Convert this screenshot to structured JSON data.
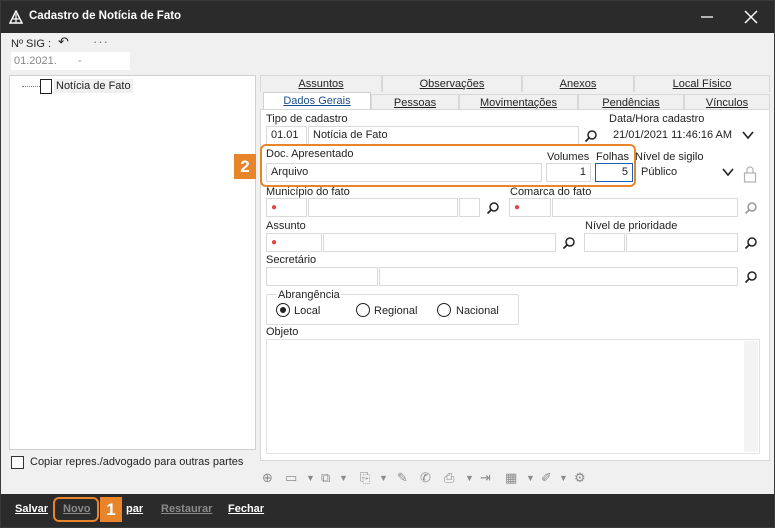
{
  "window": {
    "title": "Cadastro de Notícia de Fato"
  },
  "header": {
    "sig_label": "Nº SIG :",
    "sig_value_a": "01.2021.",
    "sig_value_b": "-"
  },
  "tree": {
    "root_label": "Notícia de Fato"
  },
  "options": {
    "copy_label": "Copiar repres./advogado para outras partes"
  },
  "tabs_top": [
    "Assuntos",
    "Observações",
    "Anexos",
    "Local Físico"
  ],
  "tabs_bottom": [
    "Dados Gerais",
    "Pessoas",
    "Movimentações",
    "Pendências",
    "Vínculos"
  ],
  "form": {
    "tipo_label": "Tipo de cadastro",
    "tipo_code": "01.01",
    "tipo_value": "Notícia de Fato",
    "data_label": "Data/Hora cadastro",
    "data_value": "21/01/2021 11:46:16 AM",
    "doc_label": "Doc. Apresentado",
    "doc_value": "Arquivo",
    "volumes_label": "Volumes",
    "volumes_value": "1",
    "folhas_label": "Folhas",
    "folhas_value": "5",
    "sigilo_label": "Nível de sigilo",
    "sigilo_value": "Público",
    "municipio_label": "Município do fato",
    "comarca_label": "Comarca do fato",
    "assunto_label": "Assunto",
    "prioridade_label": "Nível de prioridade",
    "secretario_label": "Secretário",
    "abrangencia_label": "Abrangência",
    "abrangencia_options": [
      "Local",
      "Regional",
      "Nacional"
    ],
    "objeto_label": "Objeto"
  },
  "callouts": {
    "one": "1",
    "two": "2"
  },
  "bottom_buttons": {
    "salvar": "Salvar",
    "novo": "Novo",
    "copiar": "par",
    "restaurar": "Restaurar",
    "fechar": "Fechar"
  },
  "colors": {
    "accent": "#e8852a",
    "titlebar": "#2b2b2b",
    "required": "#e04848"
  }
}
